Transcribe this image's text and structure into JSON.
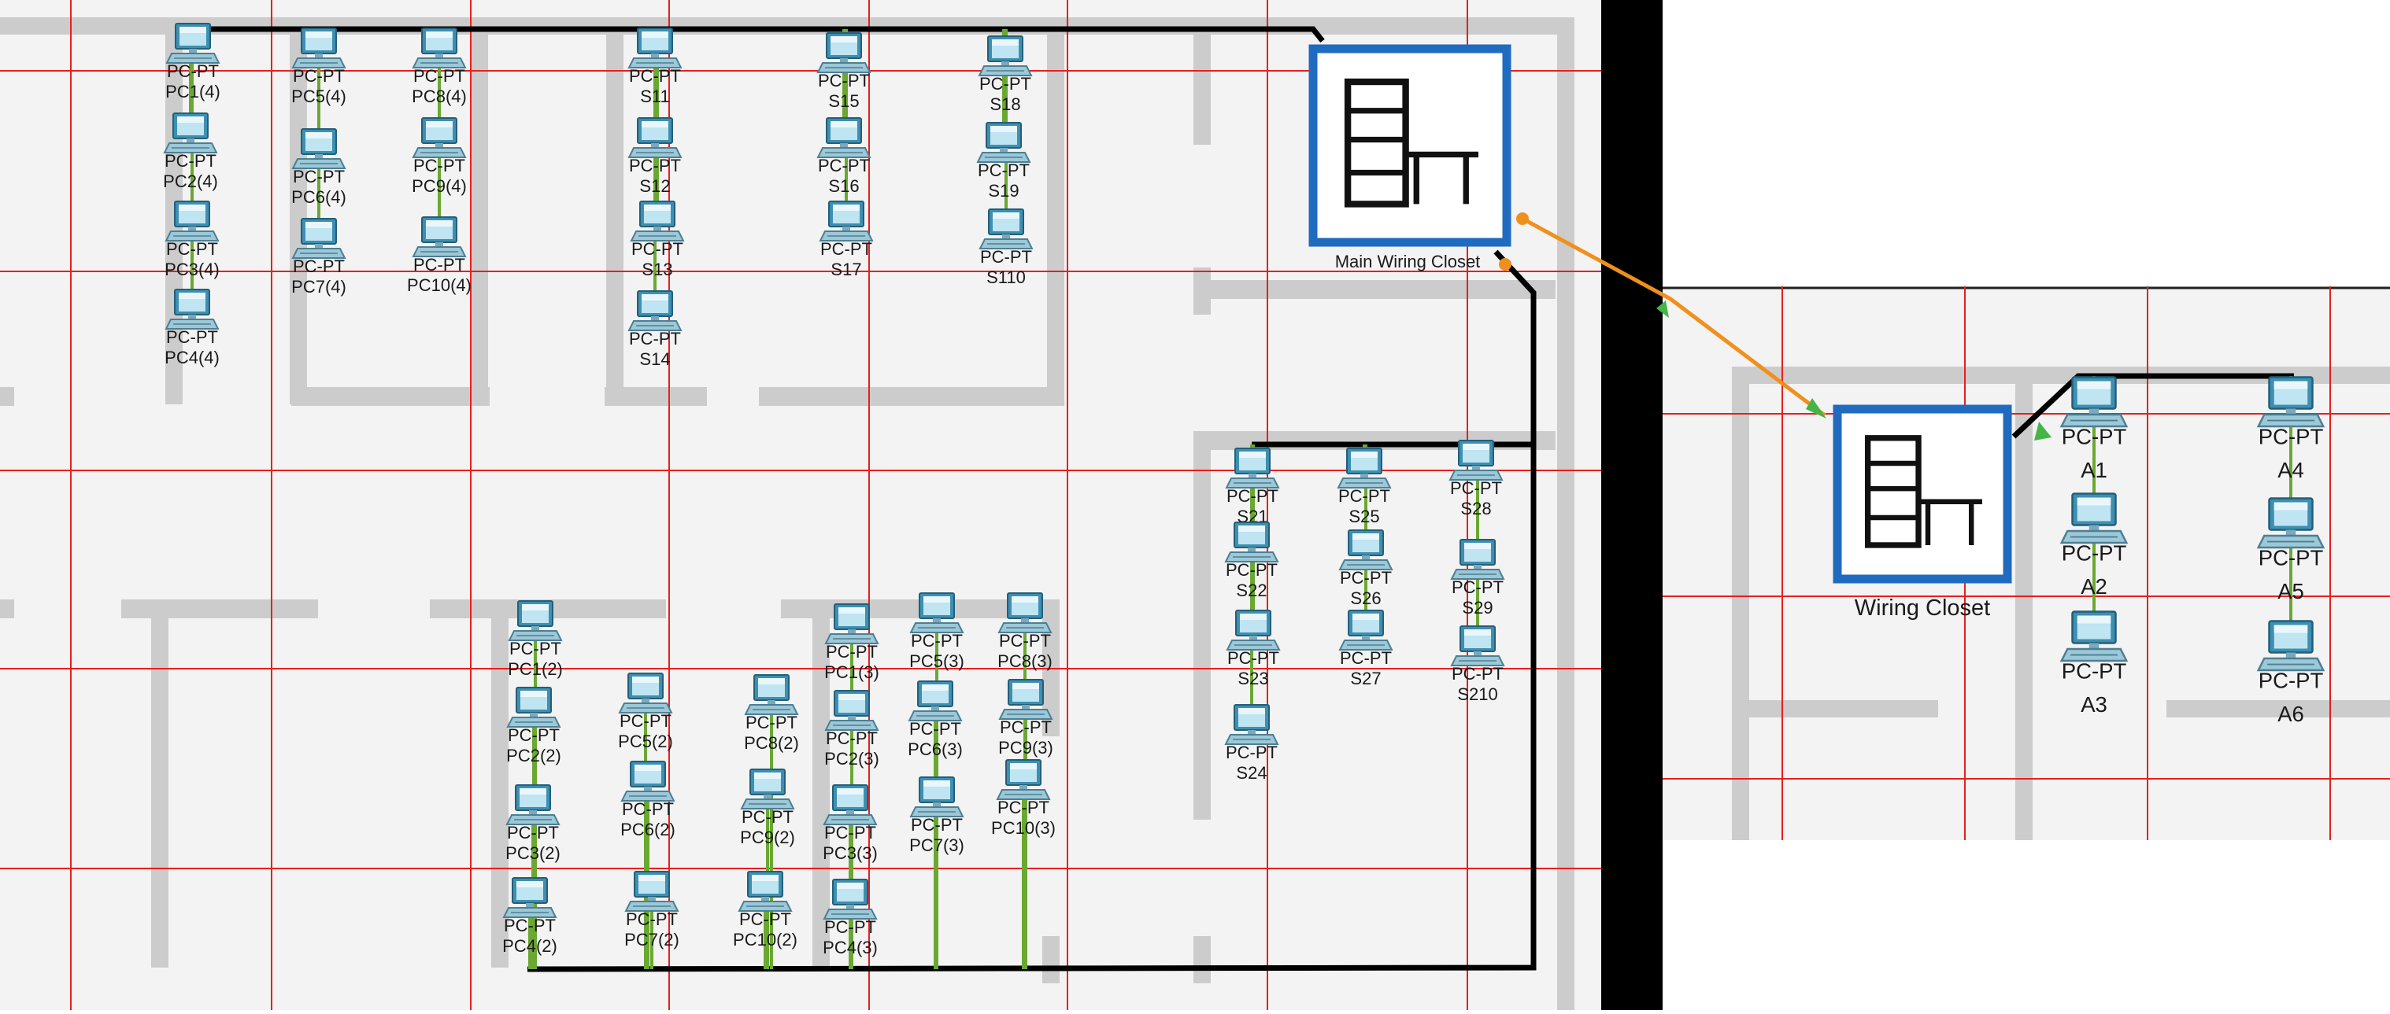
{
  "left_panel": {
    "closet_label": "Main Wiring Closet",
    "pcs": [
      {
        "id": "PC1(4)",
        "label1": "PC-PT",
        "label2": "PC1(4)"
      },
      {
        "id": "PC2(4)",
        "label1": "PC-PT",
        "label2": "PC2(4)"
      },
      {
        "id": "PC3(4)",
        "label1": "PC-PT",
        "label2": "PC3(4)"
      },
      {
        "id": "PC4(4)",
        "label1": "PC-PT",
        "label2": "PC4(4)"
      },
      {
        "id": "PC5(4)",
        "label1": "PC-PT",
        "label2": "PC5(4)"
      },
      {
        "id": "PC6(4)",
        "label1": "PC-PT",
        "label2": "PC6(4)"
      },
      {
        "id": "PC7(4)",
        "label1": "PC-PT",
        "label2": "PC7(4)"
      },
      {
        "id": "PC8(4)",
        "label1": "PC-PT",
        "label2": "PC8(4)"
      },
      {
        "id": "PC9(4)",
        "label1": "PC-PT",
        "label2": "PC9(4)"
      },
      {
        "id": "PC10(4)",
        "label1": "PC-PT",
        "label2": "PC10(4)"
      },
      {
        "id": "S11",
        "label1": "PC-PT",
        "label2": "S11"
      },
      {
        "id": "S12",
        "label1": "PC-PT",
        "label2": "S12"
      },
      {
        "id": "S13",
        "label1": "PC-PT",
        "label2": "S13"
      },
      {
        "id": "S14",
        "label1": "PC-PT",
        "label2": "S14"
      },
      {
        "id": "S15",
        "label1": "PC-PT",
        "label2": "S15"
      },
      {
        "id": "S16",
        "label1": "PC-PT",
        "label2": "S16"
      },
      {
        "id": "S17",
        "label1": "PC-PT",
        "label2": "S17"
      },
      {
        "id": "S18",
        "label1": "PC-PT",
        "label2": "S18"
      },
      {
        "id": "S19",
        "label1": "PC-PT",
        "label2": "S19"
      },
      {
        "id": "S110",
        "label1": "PC-PT",
        "label2": "S110"
      },
      {
        "id": "S21",
        "label1": "PC-PT",
        "label2": "S21"
      },
      {
        "id": "S22",
        "label1": "PC-PT",
        "label2": "S22"
      },
      {
        "id": "S23",
        "label1": "PC-PT",
        "label2": "S23"
      },
      {
        "id": "S24",
        "label1": "PC-PT",
        "label2": "S24"
      },
      {
        "id": "S25",
        "label1": "PC-PT",
        "label2": "S25"
      },
      {
        "id": "S26",
        "label1": "PC-PT",
        "label2": "S26"
      },
      {
        "id": "S27",
        "label1": "PC-PT",
        "label2": "S27"
      },
      {
        "id": "S28",
        "label1": "PC-PT",
        "label2": "S28"
      },
      {
        "id": "S29",
        "label1": "PC-PT",
        "label2": "S29"
      },
      {
        "id": "S210",
        "label1": "PC-PT",
        "label2": "S210"
      },
      {
        "id": "PC1(2)",
        "label1": "PC-PT",
        "label2": "PC1(2)"
      },
      {
        "id": "PC2(2)",
        "label1": "PC-PT",
        "label2": "PC2(2)"
      },
      {
        "id": "PC3(2)",
        "label1": "PC-PT",
        "label2": "PC3(2)"
      },
      {
        "id": "PC4(2)",
        "label1": "PC-PT",
        "label2": "PC4(2)"
      },
      {
        "id": "PC5(2)",
        "label1": "PC-PT",
        "label2": "PC5(2)"
      },
      {
        "id": "PC6(2)",
        "label1": "PC-PT",
        "label2": "PC6(2)"
      },
      {
        "id": "PC7(2)",
        "label1": "PC-PT",
        "label2": "PC7(2)"
      },
      {
        "id": "PC8(2)",
        "label1": "PC-PT",
        "label2": "PC8(2)"
      },
      {
        "id": "PC9(2)",
        "label1": "PC-PT",
        "label2": "PC9(2)"
      },
      {
        "id": "PC10(2)",
        "label1": "PC-PT",
        "label2": "PC10(2)"
      },
      {
        "id": "PC1(3)",
        "label1": "PC-PT",
        "label2": "PC1(3)"
      },
      {
        "id": "PC2(3)",
        "label1": "PC-PT",
        "label2": "PC2(3)"
      },
      {
        "id": "PC3(3)",
        "label1": "PC-PT",
        "label2": "PC3(3)"
      },
      {
        "id": "PC4(3)",
        "label1": "PC-PT",
        "label2": "PC4(3)"
      },
      {
        "id": "PC5(3)",
        "label1": "PC-PT",
        "label2": "PC5(3)"
      },
      {
        "id": "PC6(3)",
        "label1": "PC-PT",
        "label2": "PC6(3)"
      },
      {
        "id": "PC7(3)",
        "label1": "PC-PT",
        "label2": "PC7(3)"
      },
      {
        "id": "PC8(3)",
        "label1": "PC-PT",
        "label2": "PC8(3)"
      },
      {
        "id": "PC9(3)",
        "label1": "PC-PT",
        "label2": "PC9(3)"
      },
      {
        "id": "PC10(3)",
        "label1": "PC-PT",
        "label2": "PC10(3)"
      }
    ]
  },
  "right_panel": {
    "closet_label": "Wiring Closet",
    "pcs": [
      {
        "id": "A1",
        "label1": "PC-PT",
        "label2": "A1"
      },
      {
        "id": "A2",
        "label1": "PC-PT",
        "label2": "A2"
      },
      {
        "id": "A3",
        "label1": "PC-PT",
        "label2": "A3"
      },
      {
        "id": "A4",
        "label1": "PC-PT",
        "label2": "A4"
      },
      {
        "id": "A5",
        "label1": "PC-PT",
        "label2": "A5"
      },
      {
        "id": "A6",
        "label1": "PC-PT",
        "label2": "A6"
      }
    ]
  },
  "colors": {
    "wall": "#cccccc",
    "floor": "#f3f3f3",
    "grid": "#e81e1e",
    "cable_copper": "#000000",
    "cable_fiber": "#f0901c",
    "link_up": "#6aa832",
    "closet_border": "#1f6bbf",
    "divider": "#000000"
  },
  "icons": {
    "pc": "pc-workstation-icon",
    "closet": "wiring-closet-rack-icon"
  }
}
